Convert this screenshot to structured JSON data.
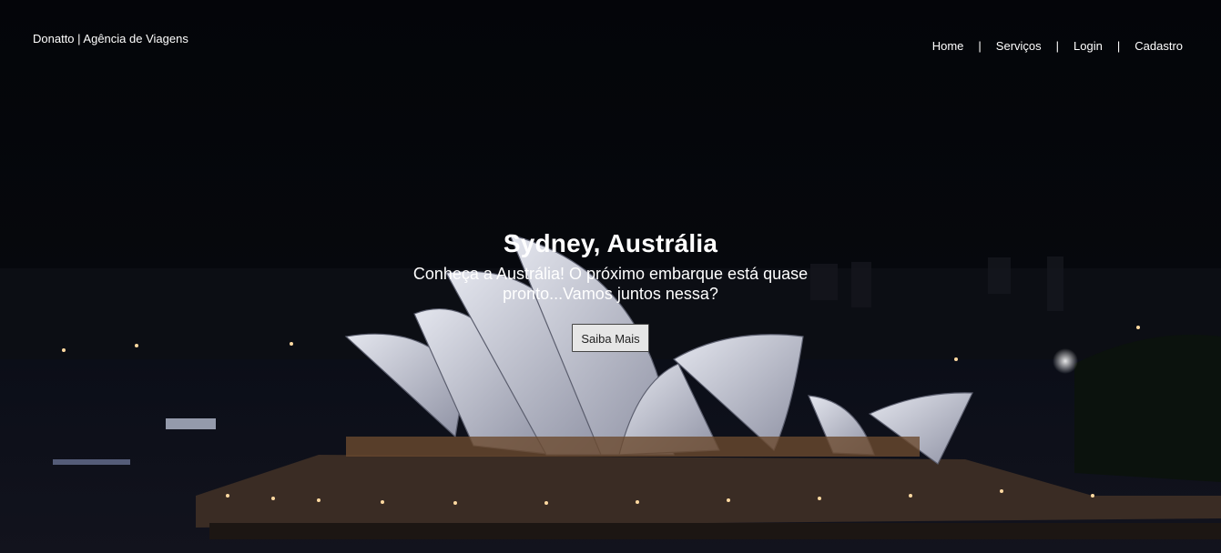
{
  "brand": {
    "title": "Donatto | Agência de Viagens"
  },
  "nav": {
    "items": [
      {
        "label": "Home"
      },
      {
        "label": "Serviços"
      },
      {
        "label": "Login"
      },
      {
        "label": "Cadastro"
      }
    ],
    "separator": "|"
  },
  "hero": {
    "title": "Sydney, Austrália",
    "subtitle": "Conheça a Austrália! O próximo embarque está quase pronto...Vamos juntos nessa?",
    "button_label": "Saiba Mais"
  },
  "colors": {
    "sky": "#05070b",
    "shell": "#c9ccd6",
    "city_light": "#ffd9a0",
    "button_bg": "#e6e6e6"
  }
}
